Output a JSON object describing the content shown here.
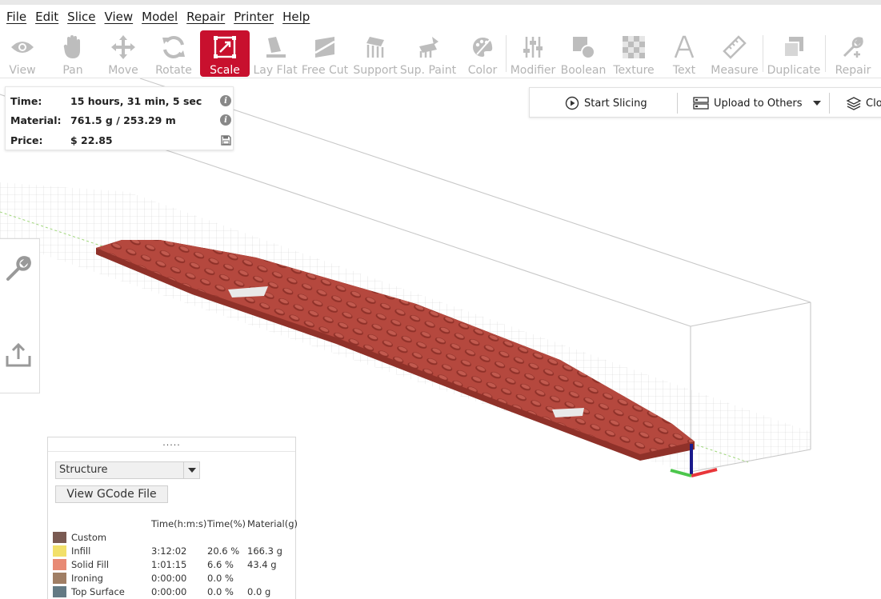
{
  "menu": [
    "File",
    "Edit",
    "Slice",
    "View",
    "Model",
    "Repair",
    "Printer",
    "Help"
  ],
  "toolbar": {
    "active": "Scale",
    "items": [
      "View",
      "Pan",
      "Move",
      "Rotate",
      "Scale",
      "Lay Flat",
      "Free Cut",
      "Support",
      "Sup. Paint",
      "Color",
      "Modifier",
      "Boolean",
      "Texture",
      "Text",
      "Measure",
      "Duplicate",
      "Repair"
    ]
  },
  "info": {
    "time_label": "Time:",
    "time_value": "15 hours, 31 min, 5 sec",
    "material_label": "Material:",
    "material_value": "761.5 g / 253.29 m",
    "price_label": "Price:",
    "price_value": "$ 22.85"
  },
  "slicebar": {
    "start_slicing": "Start Slicing",
    "upload": "Upload to Others",
    "cloud": "Clo"
  },
  "legend": {
    "handle": ".....",
    "select_value": "Structure",
    "view_gcode": "View GCode File",
    "headers": {
      "time": "Time(h:m:s)",
      "time_pct": "Time(%)",
      "material": "Material(g)"
    },
    "rows": [
      {
        "name": "Custom",
        "color": "#7a5a52",
        "time": "",
        "pct": "",
        "mat": ""
      },
      {
        "name": "Infill",
        "color": "#f2e06a",
        "time": "3:12:02",
        "pct": "20.6 %",
        "mat": "166.3 g"
      },
      {
        "name": "Solid Fill",
        "color": "#e88a74",
        "time": "1:01:15",
        "pct": "6.6 %",
        "mat": "43.4 g"
      },
      {
        "name": "Ironing",
        "color": "#a07e64",
        "time": "0:00:00",
        "pct": "0.0 %",
        "mat": ""
      },
      {
        "name": "Top Surface",
        "color": "#647a84",
        "time": "0:00:00",
        "pct": "0.0 %",
        "mat": "0.0 g"
      }
    ]
  },
  "colors": {
    "accent": "#c8102e",
    "model": "#b5483e",
    "toolbar_icon": "#bdbdbd"
  }
}
